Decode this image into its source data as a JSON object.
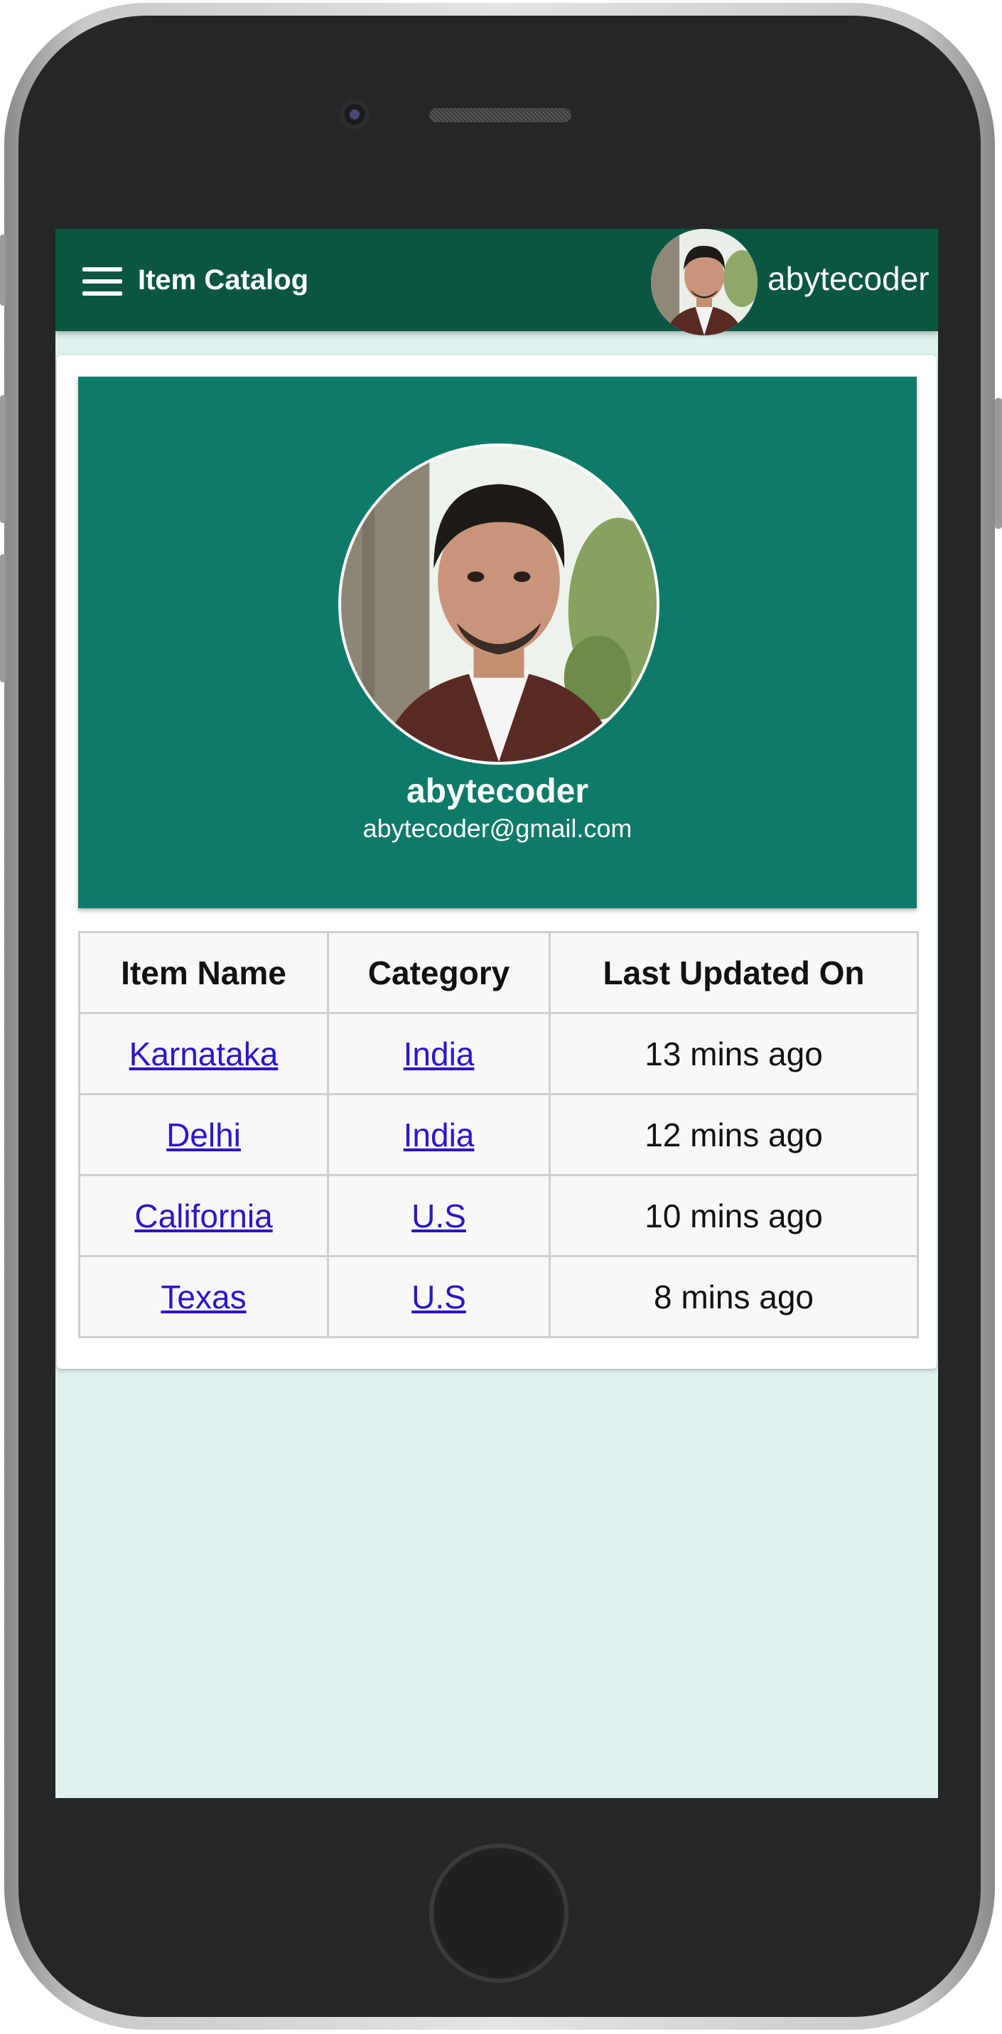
{
  "appbar": {
    "title": "Item Catalog",
    "username": "abytecoder"
  },
  "profile": {
    "name": "abytecoder",
    "email": "abytecoder@gmail.com"
  },
  "table": {
    "headers": [
      "Item Name",
      "Category",
      "Last Updated On"
    ],
    "rows": [
      {
        "item": "Karnataka",
        "category": "India",
        "updated": "13 mins ago"
      },
      {
        "item": "Delhi",
        "category": "India",
        "updated": "12 mins ago"
      },
      {
        "item": "California",
        "category": "U.S",
        "updated": "10 mins ago"
      },
      {
        "item": "Texas",
        "category": "U.S",
        "updated": "8 mins ago"
      }
    ]
  },
  "colors": {
    "appbar": "#0b5643",
    "profile_banner": "#0e7b69",
    "screen_background": "#dff1ee",
    "link": "#2a16cc"
  },
  "icons": [
    "hamburger-menu-icon",
    "user-avatar"
  ]
}
